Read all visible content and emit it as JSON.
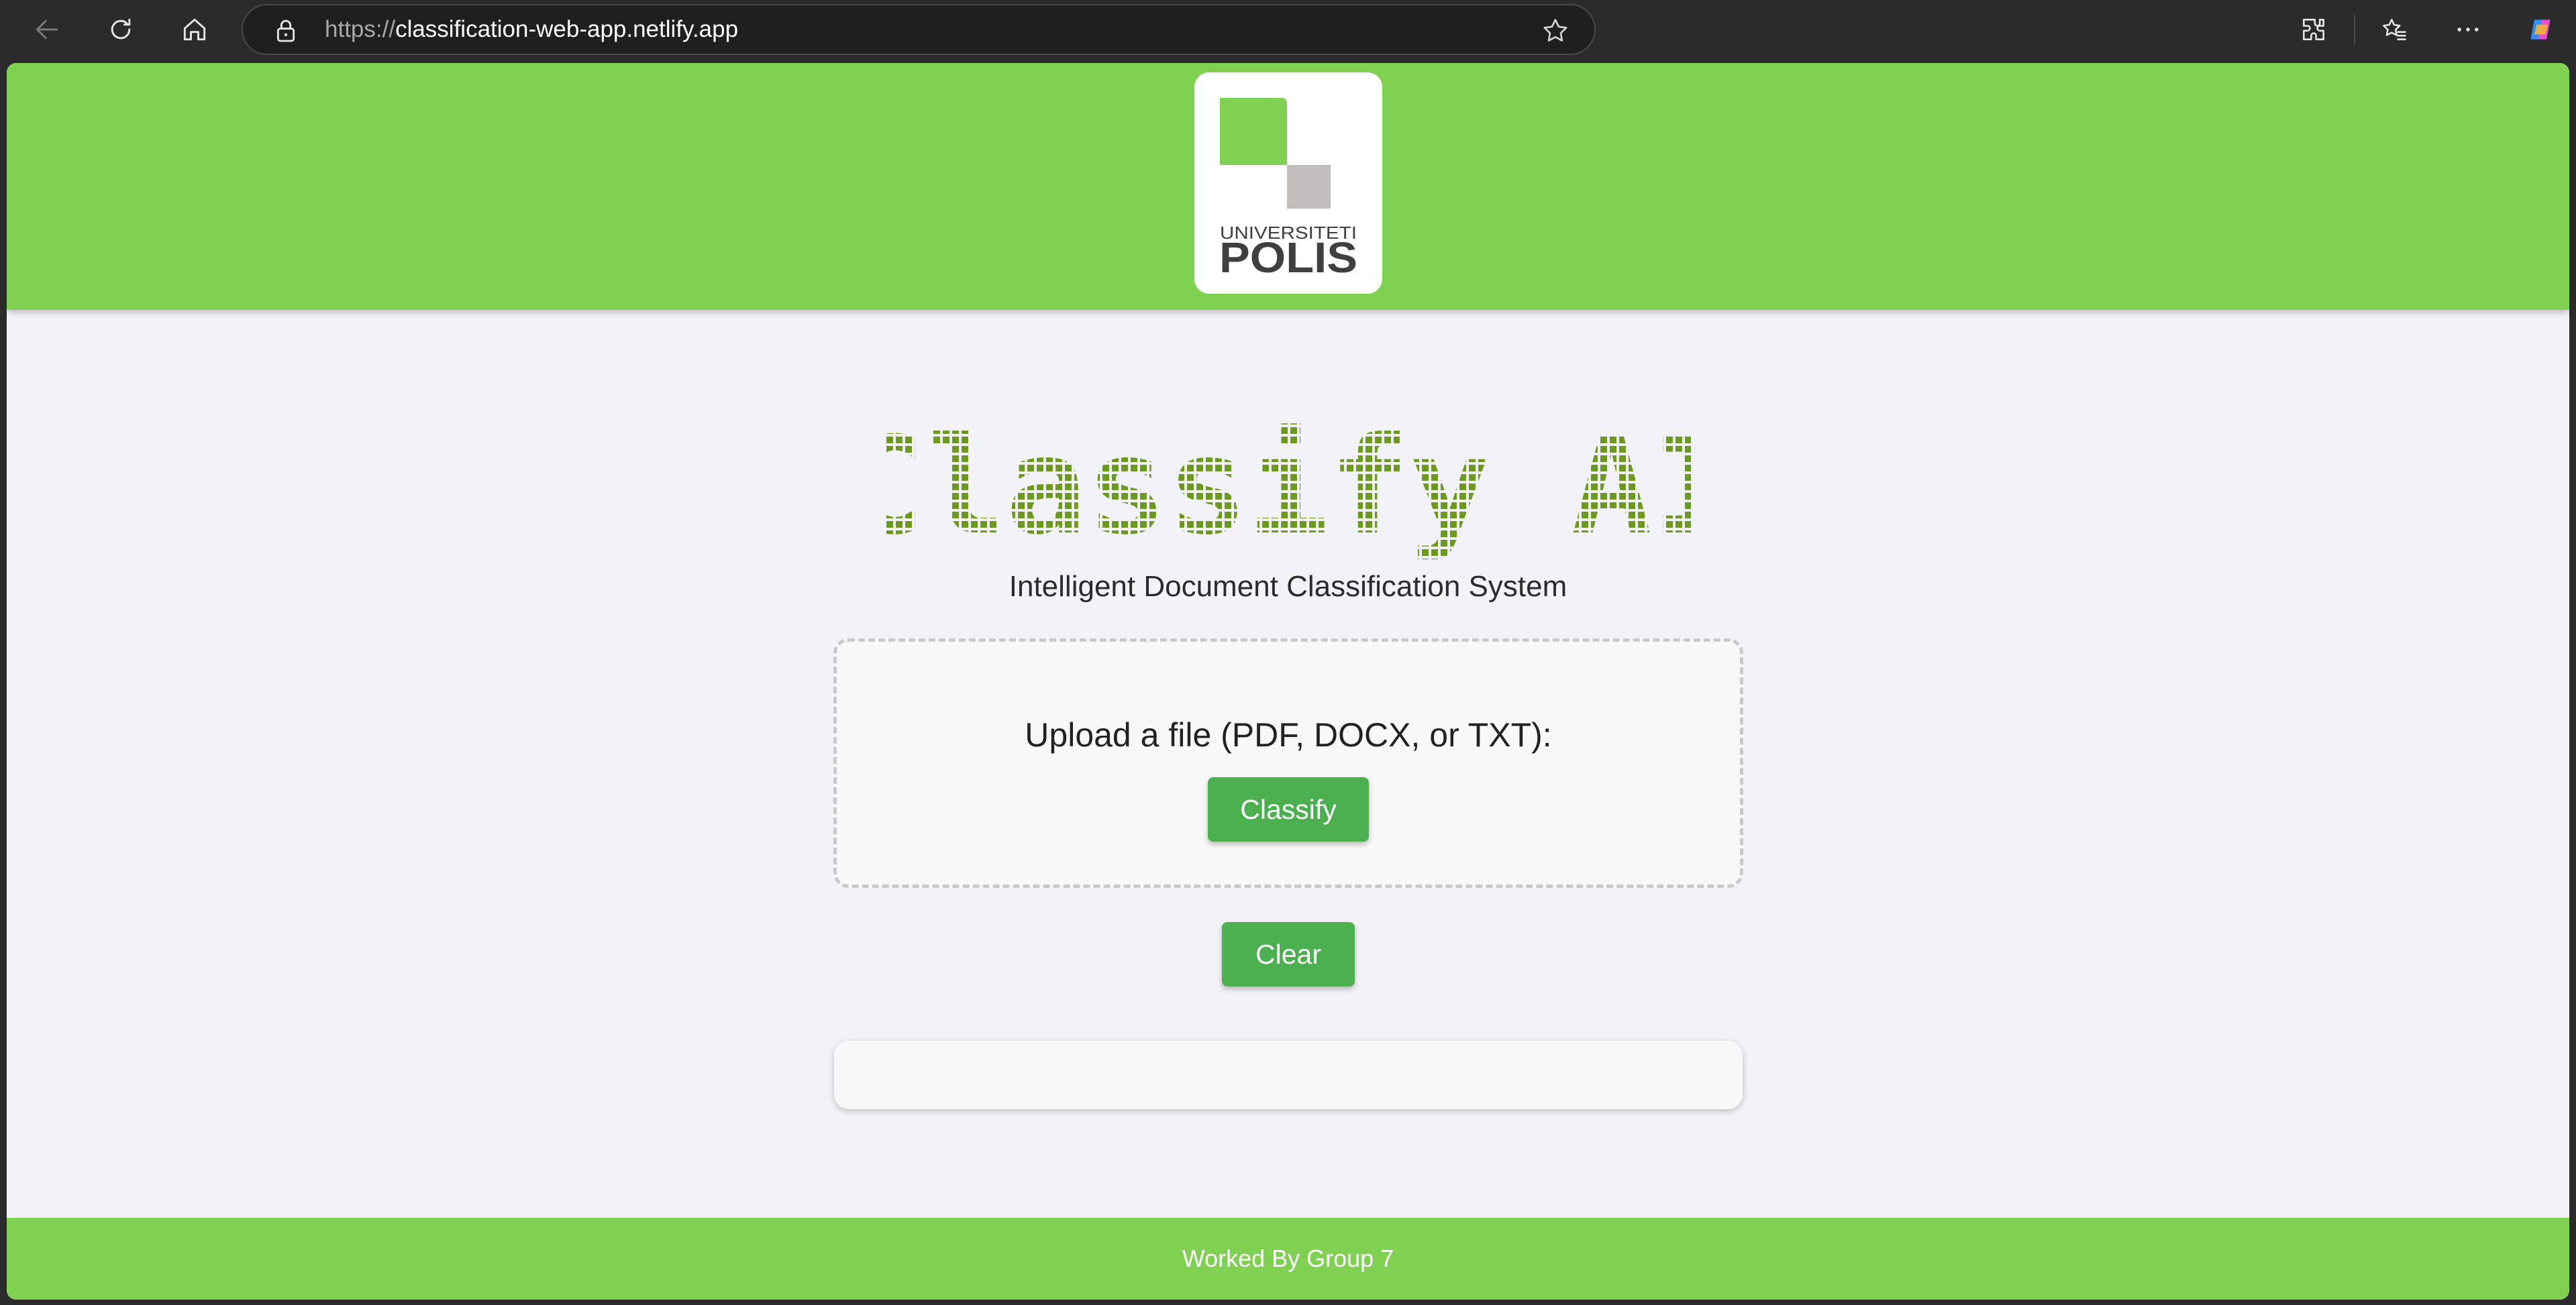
{
  "browser": {
    "url_scheme": "https://",
    "url_host": "classification-web-app.netlify.app",
    "icons": [
      "back-arrow-icon",
      "refresh-icon",
      "home-icon",
      "lock-icon",
      "star-icon",
      "extensions-icon",
      "favorites-icon",
      "more-icon",
      "copilot-icon"
    ]
  },
  "header": {
    "logo_top_text": "UNIVERSITETI",
    "logo_main_text": "POLIS",
    "background": "#80d152"
  },
  "main": {
    "title": "Classify AI",
    "title_color": "#6b9a1f",
    "subtitle": "Intelligent Document Classification System",
    "upload_label": "Upload a file (PDF, DOCX, or TXT):",
    "classify_button": "Classify",
    "clear_button": "Clear",
    "result_text": "",
    "button_color": "#4caf50"
  },
  "footer": {
    "text": "Worked By Group 7"
  }
}
